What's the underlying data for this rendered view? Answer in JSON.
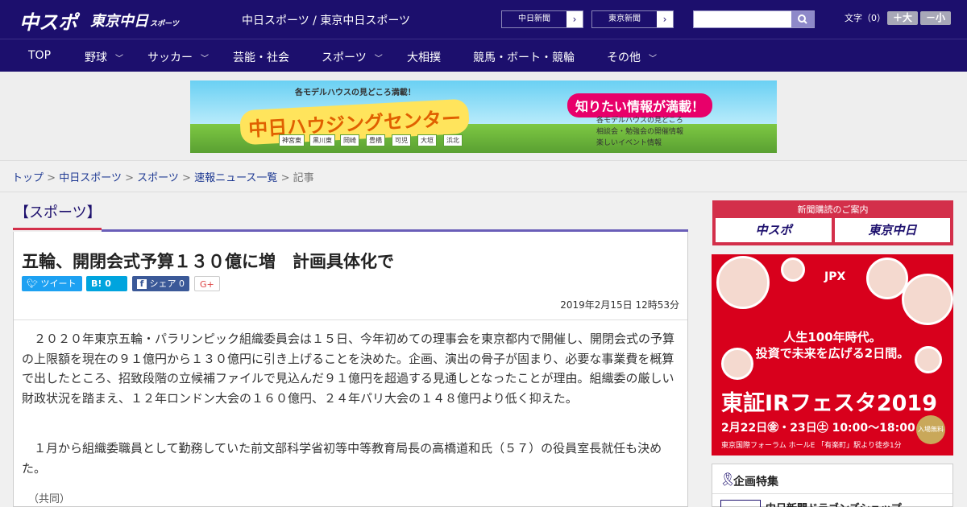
{
  "header": {
    "logo_chuspo": "中スポ",
    "logo_tokyo": "東京中日",
    "logo_tokyo_sub": "スポーツ",
    "site_title": "中日スポーツ / 東京中日スポーツ",
    "paper_links": [
      "中日新聞",
      "東京新聞"
    ],
    "search": {
      "placeholder": "",
      "value": ""
    },
    "font_size_label": "文字（0）",
    "font_larger": "＋大",
    "font_smaller": "－小"
  },
  "nav": {
    "items": [
      {
        "label": "TOP",
        "has_dropdown": false
      },
      {
        "label": "野球",
        "has_dropdown": true
      },
      {
        "label": "サッカー",
        "has_dropdown": true
      },
      {
        "label": "芸能・社会",
        "has_dropdown": false
      },
      {
        "label": "スポーツ",
        "has_dropdown": true
      },
      {
        "label": "大相撲",
        "has_dropdown": false
      },
      {
        "label": "競馬・ボート・競輪",
        "has_dropdown": false
      },
      {
        "label": "その他",
        "has_dropdown": true
      }
    ]
  },
  "ad_banner": {
    "tagline": "各モデルハウスの見どころ満載！",
    "title": "中日ハウジングセンター",
    "balloon": "知りたい情報が満載！",
    "features": [
      "各モデルハウスの見どころ",
      "相談会・勉強会の開催情報",
      "楽しいイベント情報"
    ],
    "cities": [
      "神宮東",
      "黒川東",
      "岡崎",
      "豊橋",
      "可児",
      "大垣",
      "浜北"
    ]
  },
  "breadcrumb": {
    "links": [
      "トップ",
      "中日スポーツ",
      "スポーツ",
      "速報ニュース一覧"
    ],
    "separator": ">",
    "current": "記事"
  },
  "article": {
    "section": "【スポーツ】",
    "headline": "五輪、開閉会式予算１３０億に増　計画具体化で",
    "share": {
      "tweet": "ツイート",
      "hatena": "B!",
      "hatena_count": "0",
      "facebook": "シェア",
      "facebook_count": "0",
      "gplus": "G+"
    },
    "date": "2019年2月15日 12時53分",
    "paragraphs": [
      "２０２０年東京五輪・パラリンピック組織委員会は１５日、今年初めての理事会を東京都内で開催し、開閉会式の予算の上限額を現在の９１億円から１３０億円に引き上げることを決めた。企画、演出の骨子が固まり、必要な事業費を概算で出したところ、招致段階の立候補ファイルで見込んだ９１億円を超過する見通しとなったことが理由。組織委の厳しい財政状況を踏まえ、１２年ロンドン大会の１６０億円、２４年パリ大会の１４８億円より低く抑えた。",
      "１月から組織委職員として勤務していた前文部科学省初等中等教育局長の高橋道和氏（５７）の役員室長就任も決めた。"
    ],
    "source": "（共同）"
  },
  "sidebar": {
    "subscribe_heading": "新聞購読のご案内",
    "subscribe_chuspo": "中スポ",
    "subscribe_tokyo": "東京中日",
    "ad": {
      "org": "JPX",
      "line1": "人生100年時代。",
      "line2": "投資で未来を広げる2日間。",
      "event": "東証IRフェスタ2019",
      "dates": "2月22日㊎・23日㊏ 10:00～18:00",
      "venue": "東京国際フォーラム ホールE 「有楽町」駅より徒歩1分",
      "free": "入場無料"
    },
    "feature_heading": "企画特集",
    "feature_item": "中日新聞ドラゴンズショップ"
  },
  "colors": {
    "header_bg": "#1c0f6d",
    "accent_red": "#d32f4a",
    "twitter": "#1da1f2",
    "hatena": "#00a4de",
    "facebook": "#3b5998"
  }
}
